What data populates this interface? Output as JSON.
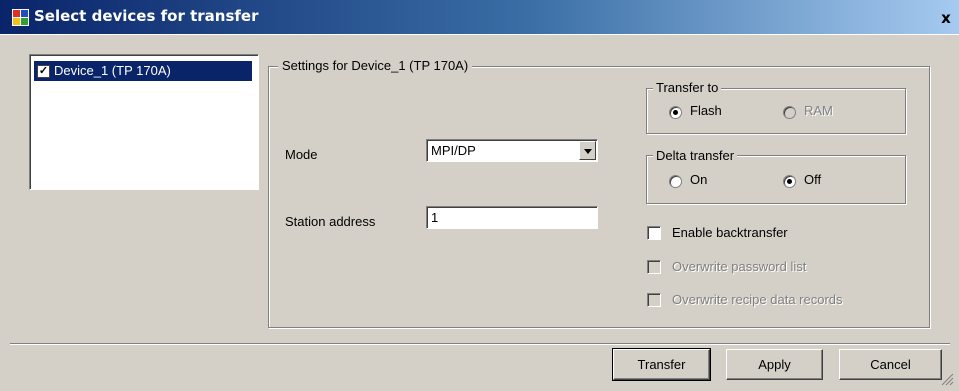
{
  "window": {
    "title": "Select devices for transfer",
    "close_label": "x"
  },
  "device_list": {
    "items": [
      {
        "label": "Device_1 (TP 170A)",
        "checked": true,
        "check_mark": "✓"
      }
    ]
  },
  "settings": {
    "group_title": "Settings for Device_1 (TP 170A)",
    "mode_label": "Mode",
    "mode_value": "MPI/DP",
    "station_label": "Station address",
    "station_value": "1",
    "transfer_to": {
      "title": "Transfer to",
      "option_flash": "Flash",
      "option_ram": "RAM",
      "selected": "Flash"
    },
    "delta_transfer": {
      "title": "Delta transfer",
      "option_on": "On",
      "option_off": "Off",
      "selected": "Off"
    },
    "enable_backtransfer": {
      "label": "Enable backtransfer",
      "checked": false
    },
    "overwrite_password": {
      "label": "Overwrite password list",
      "checked": false,
      "enabled": false
    },
    "overwrite_recipe": {
      "label": "Overwrite recipe data records",
      "checked": false,
      "enabled": false
    }
  },
  "buttons": {
    "transfer": "Transfer",
    "apply": "Apply",
    "cancel": "Cancel"
  },
  "colors": {
    "title_bar_start": "#0a246a",
    "title_bar_end": "#a6caf0",
    "selection": "#0a246a",
    "face": "#d4d0c8"
  }
}
